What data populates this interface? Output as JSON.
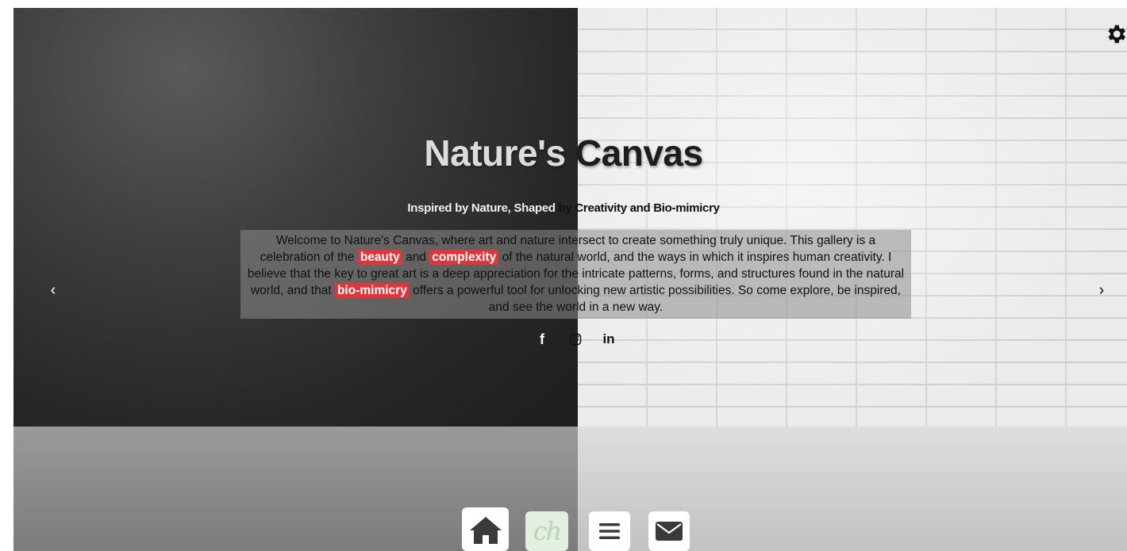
{
  "hero": {
    "title_left": "Nature's",
    "title_right": " Canvas",
    "subtitle_left": "Inspired by Nature, Shaped ",
    "subtitle_right": "by Creativity and Bio-mimicry"
  },
  "intro": {
    "text_1": "Welcome to Nature's Canvas, where art and nature intersect to create something truly unique. This gallery is a celebration of the ",
    "highlight_1": "beauty",
    "text_2": " and ",
    "highlight_2": "complexity",
    "text_3": " of the natural world, and the ways in which it inspires human creativity. I believe that the key to great art is a deep appreciation for the intricate patterns, forms, and structures found in the natural world, and that ",
    "highlight_3": "bio-mimicry",
    "text_4": " offers a powerful tool for unlocking new artistic possibilities. So come explore, be inspired, and see the world in a new way."
  },
  "social": {
    "facebook_label": "f",
    "linkedin_label": "in"
  },
  "carousel": {
    "prev_label": "‹",
    "next_label": "›"
  },
  "nav": {
    "logo_text": "ch"
  },
  "icons": {
    "settings": "gear-icon",
    "home": "home-icon",
    "menu": "hamburger-icon",
    "mail": "envelope-icon",
    "facebook": "facebook-icon",
    "instagram": "instagram-icon",
    "linkedin": "linkedin-icon"
  },
  "colors": {
    "highlight": "#e0353b",
    "logo_bg": "#e3efe0"
  }
}
